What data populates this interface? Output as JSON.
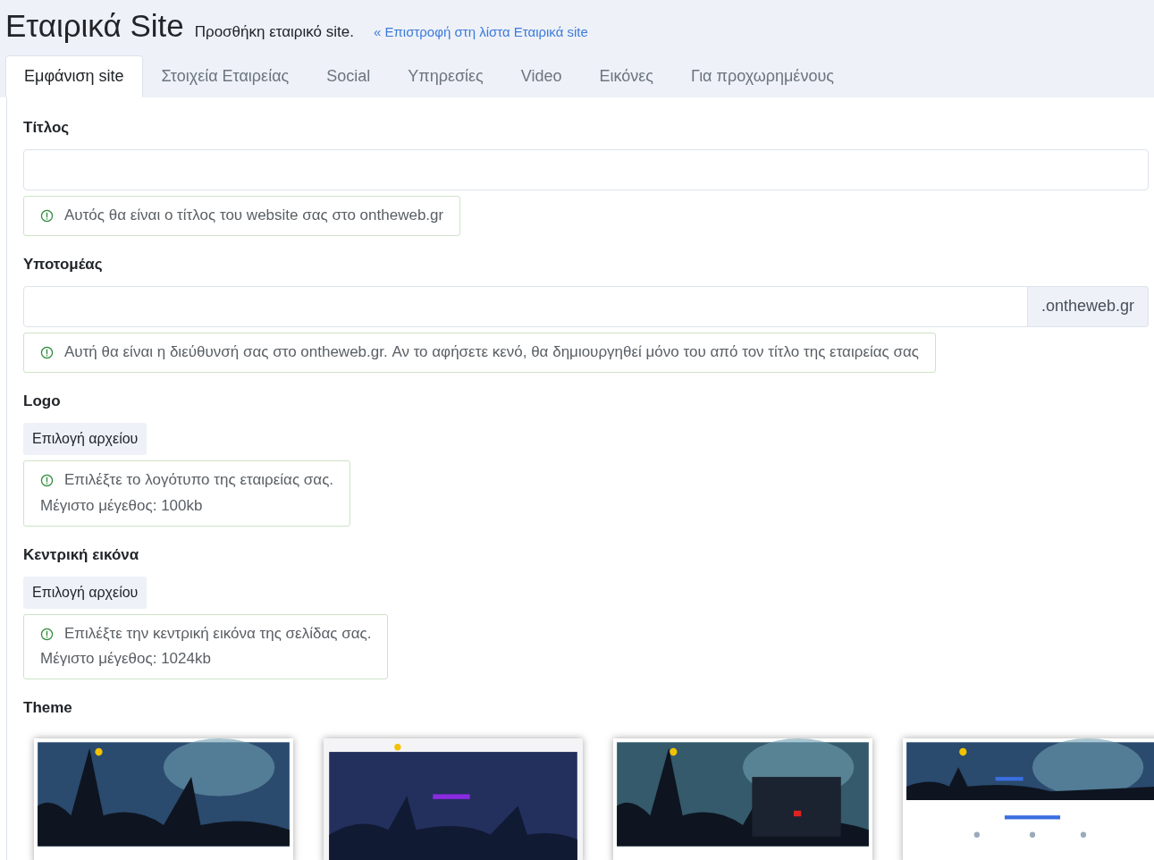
{
  "header": {
    "title": "Εταιρικά Site",
    "subtitle": "Προσθήκη εταιρικό site.",
    "back_link": "« Επιστροφή στη λίστα Εταιρικά site"
  },
  "tabs": [
    {
      "label": "Εμφάνιση site",
      "selected": true
    },
    {
      "label": "Στοιχεία Εταιρείας",
      "selected": false
    },
    {
      "label": "Social",
      "selected": false
    },
    {
      "label": "Υπηρεσίες",
      "selected": false
    },
    {
      "label": "Video",
      "selected": false
    },
    {
      "label": "Εικόνες",
      "selected": false
    },
    {
      "label": "Για προχωρημένους",
      "selected": false
    }
  ],
  "fields": [
    {
      "kind": "text",
      "label": "Τίτλος",
      "hint": "Αυτός θα είναι ο τίτλος του website σας στο ontheweb.gr"
    },
    {
      "kind": "suffix",
      "label": "Υποτομέας",
      "suffix": ".ontheweb.gr",
      "hint": "Αυτή θα είναι η διεύθυνσή σας στο ontheweb.gr. Αν το αφήσετε κενό, θα δημιουργηθεί μόνο του από τον τίτλο της εταιρείας σας"
    },
    {
      "kind": "file",
      "label": "Logo",
      "button": "Επιλογή αρχείου",
      "hint": "Επιλέξτε το λογότυπο της εταιρείας σας.",
      "note": "Μέγιστο μέγεθος: 100kb"
    },
    {
      "kind": "file",
      "label": "Κεντρική εικόνα",
      "button": "Επιλογή αρχείου",
      "hint": "Επιλέξτε την κεντρική εικόνα της σελίδας σας.",
      "note": "Μέγιστο μέγεθος: 1024kb"
    }
  ],
  "theme": {
    "label": "Theme"
  }
}
